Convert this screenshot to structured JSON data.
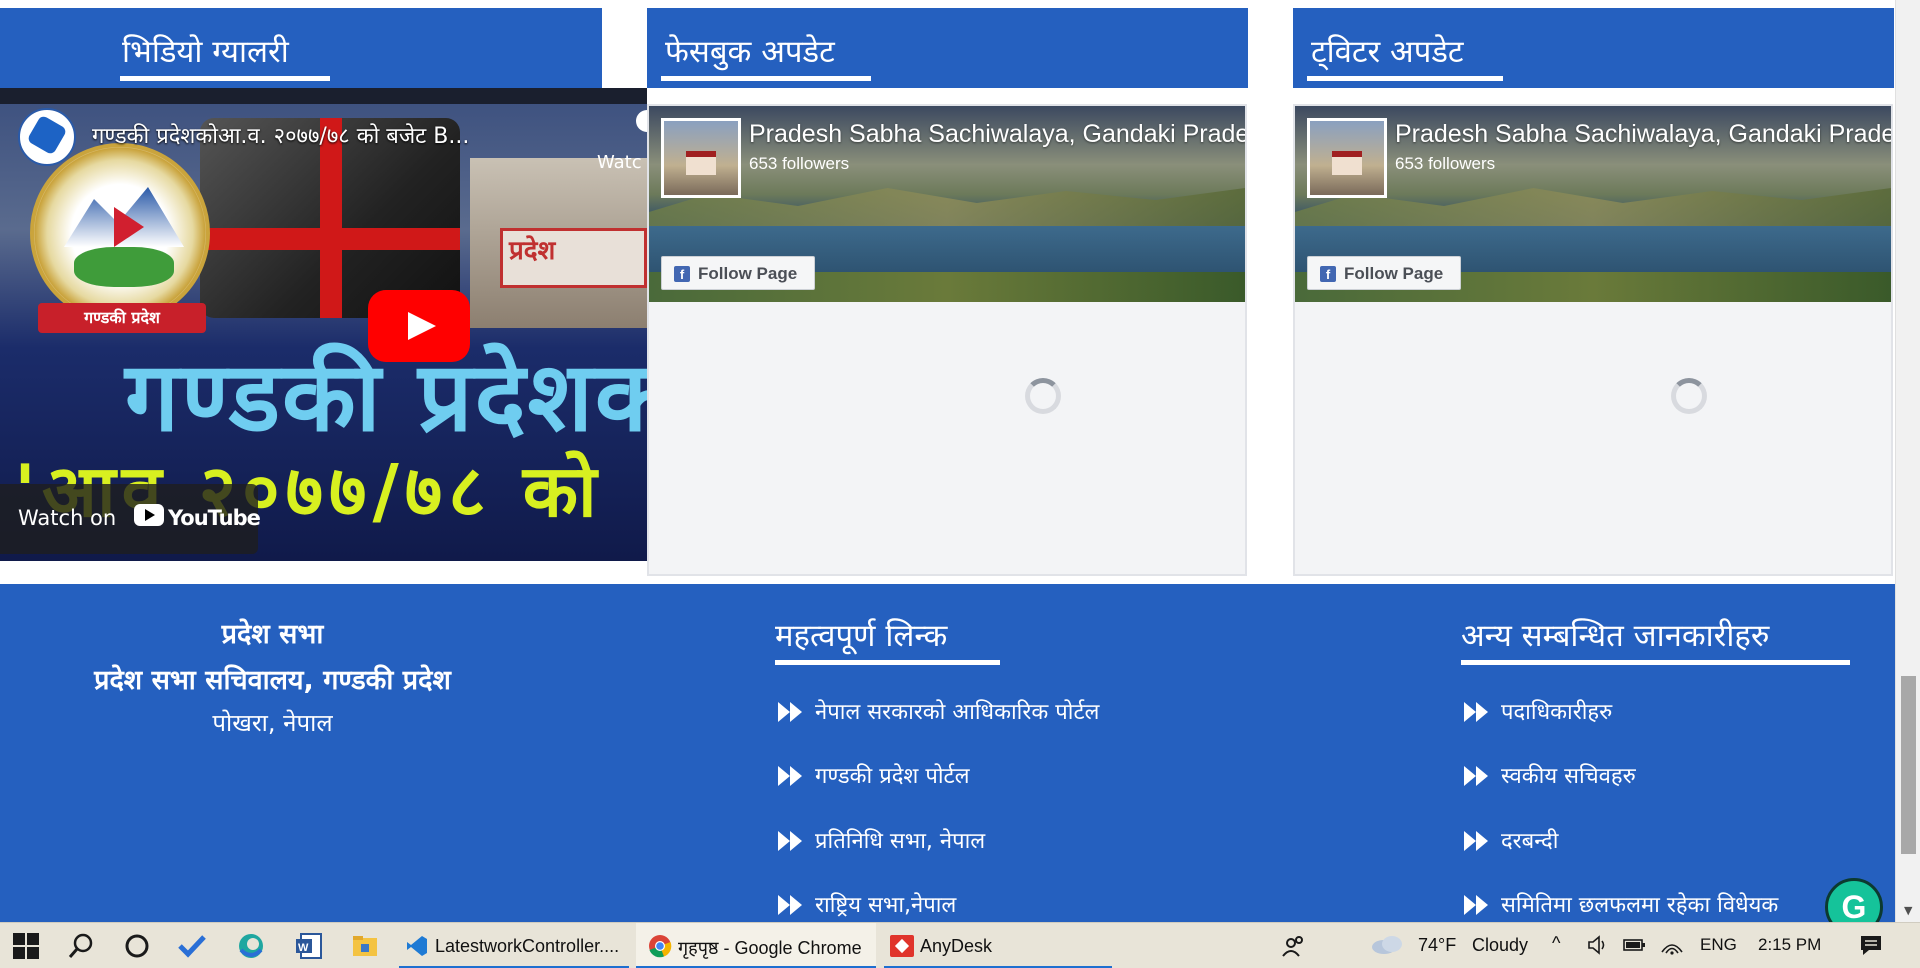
{
  "sections": {
    "video_title": "भिडियो ग्यालरी",
    "facebook_title": "फेसबुक अपडेट",
    "twitter_title": "ट्विटर अपडेट"
  },
  "video": {
    "title": "गण्डकी प्रदेशकोआ.व. २०७७/७८ को बजेट B...",
    "watch_later": "Watc",
    "overlay_line1": "गण्डकी प्रदेशक",
    "overlay_line2": "'आव २०७७/७८ को",
    "emblem_label": "गण्डकी प्रदेश",
    "sign_text": "प्रदेश",
    "watch_on": "Watch on",
    "youtube": "YouTube"
  },
  "fb_widgets": [
    {
      "page_name": "Pradesh Sabha Sachiwalaya, Gandaki Pradesh",
      "followers": "653 followers",
      "follow_label": "Follow Page"
    },
    {
      "page_name": "Pradesh Sabha Sachiwalaya, Gandaki Pradesh",
      "followers": "653 followers",
      "follow_label": "Follow Page"
    }
  ],
  "footer": {
    "org_name": "प्रदेश सभा",
    "org_secretariat": "प्रदेश सभा सचिवालय, गण्डकी प्रदेश",
    "org_location": "पोखरा, नेपाल",
    "important_links_title": "महत्वपूर्ण लिन्क",
    "important_links": [
      "नेपाल सरकारको आधिकारिक पोर्टल",
      "गण्डकी प्रदेश पोर्टल",
      "प्रतिनिधि सभा, नेपाल",
      "राष्ट्रिय सभा,नेपाल"
    ],
    "related_info_title": "अन्य सम्बन्धित जानकारीहरु",
    "related_info": [
      "पदाधिकारीहरु",
      "स्वकीय सचिवहरु",
      "दरबन्दी",
      "समितिमा छलफलमा रहेका विधेयक"
    ]
  },
  "taskbar": {
    "apps": [
      {
        "label": "LatestworkController...."
      },
      {
        "label": "गृहपृष्ठ - Google Chrome"
      },
      {
        "label": "AnyDesk"
      }
    ],
    "weather_temp": "74°F",
    "weather_desc": "Cloudy",
    "language": "ENG",
    "time": "2:15 PM"
  },
  "colors": {
    "brand_blue": "#2560bf",
    "youtube_red": "#ff0000",
    "facebook_blue": "#4267b2",
    "grammarly_green": "#15c39a"
  }
}
